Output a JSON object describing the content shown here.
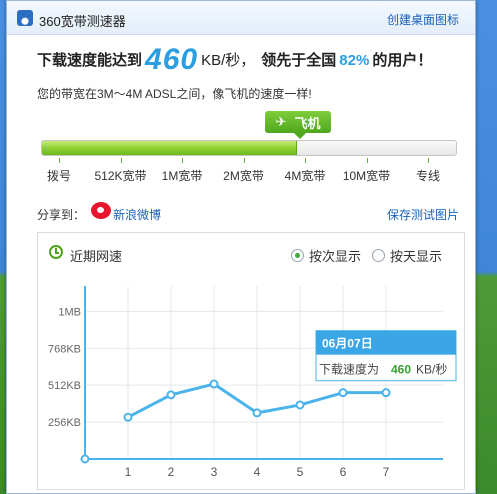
{
  "window": {
    "title": "360宽带测速器",
    "shortcut_link": "创建桌面图标"
  },
  "result": {
    "prefix": "下载速度能达到",
    "speed_value": "460",
    "speed_unit": "KB/秒，",
    "rank_prefix": "领先于全国",
    "rank_percent": "82%",
    "rank_suffix": "的用户！",
    "comparison": "您的带宽在3M～4M ADSL之间，像飞机的速度一样!",
    "badge_icon": "airplane-icon",
    "badge_label": "飞机",
    "bar_progress": 0.615
  },
  "scale": {
    "labels": [
      "拨号",
      "512K宽带",
      "1M宽带",
      "2M宽带",
      "4M宽带",
      "10M宽带",
      "专线"
    ]
  },
  "share": {
    "label": "分享到：",
    "weibo_label": "新浪微博",
    "save_label": "保存测试图片"
  },
  "history": {
    "title": "近期网速",
    "options": [
      {
        "label": "按次显示",
        "checked": true
      },
      {
        "label": "按天显示",
        "checked": false
      }
    ],
    "tooltip": {
      "date": "06月07日",
      "label": "下载速度为",
      "value": "460",
      "unit": "KB/秒"
    }
  },
  "colors": {
    "accent_blue": "#2a9ee0",
    "bar_green": "#8fd032",
    "line_blue": "#4ab3ea",
    "link_blue": "#1a61b8"
  },
  "chart_data": {
    "type": "line",
    "categories": [
      "1",
      "2",
      "3",
      "4",
      "5",
      "6",
      "7"
    ],
    "series": [
      {
        "values": [
          290,
          445,
          520,
          320,
          375,
          460,
          460
        ]
      }
    ],
    "ytick_labels": [
      "256KB",
      "512KB",
      "768KB",
      "1MB"
    ],
    "ytick_values": [
      256,
      512,
      768,
      1024
    ],
    "ylim": [
      0,
      1200
    ],
    "grid": true,
    "highlight_index": 6
  }
}
